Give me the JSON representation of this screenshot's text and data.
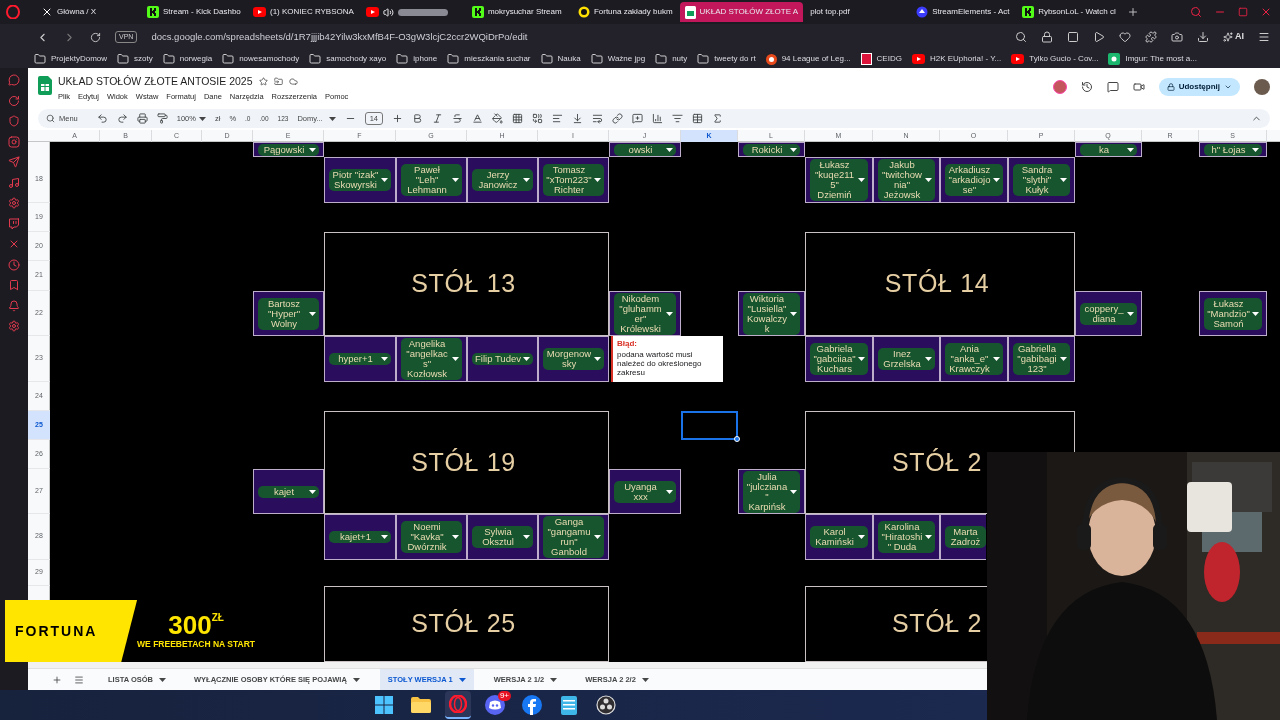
{
  "browser": {
    "tabs": [
      {
        "kind": "x",
        "title": "Główna / X",
        "selected": false
      },
      {
        "kind": "kick",
        "title": "Stream - Kick Dashbo",
        "selected": false
      },
      {
        "kind": "youtube",
        "title": "(1) KONIEC RYBSONA",
        "selected": false
      },
      {
        "kind": "blurred",
        "selected": false
      },
      {
        "kind": "kick",
        "title": "mokrysuchar Stream",
        "selected": false
      },
      {
        "kind": "fortuna",
        "title": "Fortuna zakłady bukm",
        "selected": false
      },
      {
        "kind": "sheets",
        "title": "UKŁAD STOŁÓW ZŁOTE A",
        "selected": true
      },
      {
        "kind": "pdf",
        "title": "plot top.pdf",
        "selected": false
      },
      {
        "kind": "streamelements",
        "title": "StreamElements - Act",
        "selected": false
      },
      {
        "kind": "kick",
        "title": "RybsonLoL - Watch cl",
        "selected": false
      }
    ],
    "vpn": "VPN",
    "address": "docs.google.com/spreadsheets/d/1R7jjjib42Yilw3kxMfB4F-O3gW3lcjC2ccr2WQiDrPo/edit",
    "ai": "AI",
    "bookmarks": [
      {
        "kind": "folder",
        "label": "ProjektyDomow"
      },
      {
        "kind": "folder",
        "label": "szoty"
      },
      {
        "kind": "folder",
        "label": "norwegia"
      },
      {
        "kind": "folder",
        "label": "nowesamochody"
      },
      {
        "kind": "folder",
        "label": "samochody xayo"
      },
      {
        "kind": "folder",
        "label": "iphone"
      },
      {
        "kind": "folder",
        "label": "mieszkania suchar"
      },
      {
        "kind": "folder",
        "label": "Nauka"
      },
      {
        "kind": "folder",
        "label": "Ważne jpg"
      },
      {
        "kind": "folder",
        "label": "nuty"
      },
      {
        "kind": "folder",
        "label": "tweety do rt"
      },
      {
        "kind": "league",
        "label": "94 League of Leg..."
      },
      {
        "kind": "ceidg",
        "label": "CEIDG"
      },
      {
        "kind": "youtube",
        "label": "H2K EUphoria! - Y..."
      },
      {
        "kind": "youtube",
        "label": "Tylko Gucio - Cov..."
      },
      {
        "kind": "imgur",
        "label": "Imgur: The most a..."
      }
    ]
  },
  "sheet": {
    "title": "UKŁAD STOŁÓW ZŁOTE ANTOSIE 2025",
    "menu": [
      "Plik",
      "Edytuj",
      "Widok",
      "Wstaw",
      "Formatuj",
      "Dane",
      "Narzędzia",
      "Rozszerzenia",
      "Pomoc"
    ],
    "share": "Udostępnij",
    "toolbar": {
      "search": "Menu",
      "zoom": "100%",
      "currency": "zł",
      "percent": "%",
      "dec_less": ".0",
      "dec_more": ".00",
      "format": "123",
      "font": "Domy...",
      "font_size": "14"
    },
    "columns": [
      {
        "label": "A",
        "selected": false
      },
      {
        "label": "B",
        "selected": false
      },
      {
        "label": "C",
        "selected": false
      },
      {
        "label": "D",
        "selected": false
      },
      {
        "label": "E",
        "selected": false
      },
      {
        "label": "F",
        "selected": false
      },
      {
        "label": "G",
        "selected": false
      },
      {
        "label": "H",
        "selected": false
      },
      {
        "label": "I",
        "selected": false
      },
      {
        "label": "J",
        "selected": false
      },
      {
        "label": "K",
        "selected": true
      },
      {
        "label": "L",
        "selected": false
      },
      {
        "label": "M",
        "selected": false
      },
      {
        "label": "N",
        "selected": false
      },
      {
        "label": "O",
        "selected": false
      },
      {
        "label": "P",
        "selected": false
      },
      {
        "label": "Q",
        "selected": false
      },
      {
        "label": "R",
        "selected": false
      },
      {
        "label": "S",
        "selected": false
      }
    ],
    "rows": [
      {
        "label": "18",
        "selected": false
      },
      {
        "label": "19",
        "selected": false
      },
      {
        "label": "20",
        "selected": false
      },
      {
        "label": "21",
        "selected": false
      },
      {
        "label": "22",
        "selected": false
      },
      {
        "label": "23",
        "selected": false
      },
      {
        "label": "24",
        "selected": false
      },
      {
        "label": "25",
        "selected": true
      },
      {
        "label": "26",
        "selected": false
      },
      {
        "label": "27",
        "selected": false
      },
      {
        "label": "28",
        "selected": false
      },
      {
        "label": "29",
        "selected": false
      }
    ],
    "tables": [
      {
        "left": "Pągowski",
        "right": "owski",
        "bottom": [
          "Piotr \"izak\" Skowyrski",
          "Paweł \"Leh\" Lehmann",
          "Jerzy Janowicz",
          "Tomasz \"xTom223\" Richter"
        ]
      },
      {
        "left": "Rokicki",
        "right": "ka",
        "bottom": [
          "Łukasz \"kuqe2115\" Dziemiń",
          "Jakub \"twitchownia\" Jeżowsk",
          "Arkadiusz \"arkadiojose\"",
          "Sandra \"slythi\" Kułyk"
        ]
      },
      {
        "name": "STÓŁ 13",
        "left": "Bartosz \"Hyper\" Wolny",
        "right": "Nikodem \"gluhammer\" Królewski",
        "bottom": [
          "hyper+1",
          "Angelika \"angelkacs\" Kozłowsk",
          "Filip Tudev",
          "Morgenowsky"
        ]
      },
      {
        "name": "STÓŁ 14",
        "left": "Wiktoria \"Lusiella\" Kowalczyk",
        "right": "coppery_diana",
        "bottom": [
          "Gabriela \"gabciiaa\" Kuchars",
          "Inez Grzelska",
          "Ania \"anka_e\" Krawczyk",
          "Gabriella \"gabibagi123\""
        ]
      },
      {
        "name": "STÓŁ 19",
        "left": "kajet",
        "right": "Uyanga xxx",
        "bottom": [
          "kajet+1",
          "Noemi \"Kavka\" Dwórznik",
          "Sylwia Oksztul",
          "Ganga \"gangamurun\" Ganbold"
        ]
      },
      {
        "name": "STÓŁ 2",
        "left": "Julia \"julcziana\" Karpińsk",
        "bottom": [
          "Karol Kamiński",
          "Karolina \"Hiratoshi\" Duda",
          "Marta Zadroż"
        ]
      },
      {
        "name": "STÓŁ 25"
      },
      {
        "name": "STÓŁ 2"
      }
    ],
    "edge_seats": [
      "h\" Łojas",
      "Łukasz \"Mandzio\" Samoń"
    ],
    "error_tooltip": {
      "title": "Błąd:",
      "message": "podana wartość musi należeć do określonego zakresu"
    },
    "sheet_tabs": [
      {
        "label": "LISTA OSÓB",
        "selected": false
      },
      {
        "label": "WYŁĄCZNIE OSOBY KTÓRE SIĘ POJAWIĄ",
        "selected": false
      },
      {
        "label": "STOŁY WERSJA 1",
        "selected": true
      },
      {
        "label": "WERSJA 2 1/2",
        "selected": false
      },
      {
        "label": "WERSJA 2 2/2",
        "selected": false
      }
    ]
  },
  "ad": {
    "brand": "FORTUNA",
    "amount": "300",
    "currency": "ZŁ",
    "tagline": "WE FREEBETACH NA START"
  },
  "taskbar": [
    {
      "kind": "windows",
      "active": false
    },
    {
      "kind": "folder",
      "active": false
    },
    {
      "kind": "opera",
      "active": true
    },
    {
      "kind": "discord",
      "badge": "9+",
      "active": false
    },
    {
      "kind": "facebook",
      "active": false
    },
    {
      "kind": "notepad",
      "active": false
    },
    {
      "kind": "obs",
      "active": false
    }
  ]
}
